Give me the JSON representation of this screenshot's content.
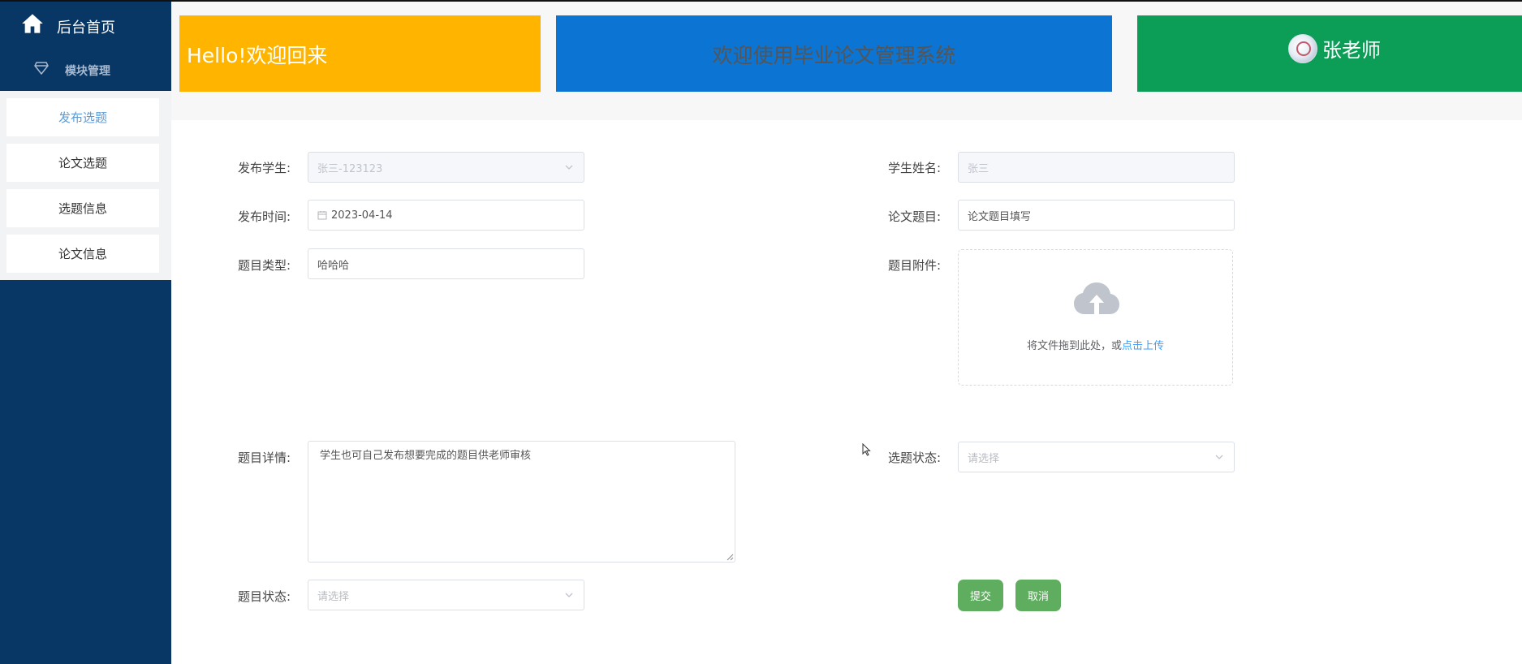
{
  "sidebar": {
    "home_label": "后台首页",
    "module_label": "模块管理",
    "items": [
      {
        "label": "发布选题",
        "active": true
      },
      {
        "label": "论文选题",
        "active": false
      },
      {
        "label": "选题信息",
        "active": false
      },
      {
        "label": "论文信息",
        "active": false
      }
    ]
  },
  "header": {
    "greeting": "Hello!欢迎回来",
    "system_title": "欢迎使用毕业论文管理系统",
    "user_name": "张老师"
  },
  "form": {
    "publish_student": {
      "label": "发布学生:",
      "value": "张三-123123"
    },
    "student_name": {
      "label": "学生姓名:",
      "value": "张三"
    },
    "publish_time": {
      "label": "发布时间:",
      "value": "2023-04-14"
    },
    "thesis_title": {
      "label": "论文题目:",
      "value": "论文题目填写"
    },
    "topic_type": {
      "label": "题目类型:",
      "value": "哈哈哈"
    },
    "attachment": {
      "label": "题目附件:",
      "hint": "将文件拖到此处，或",
      "link": "点击上传"
    },
    "topic_detail": {
      "label": "题目详情:",
      "value": "学生也可自己发布想要完成的题目供老师审核"
    },
    "selection_status": {
      "label": "选题状态:",
      "placeholder": "请选择"
    },
    "topic_status": {
      "label": "题目状态:",
      "placeholder": "请选择"
    },
    "submit_label": "提交",
    "cancel_label": "取消"
  },
  "colors": {
    "sidebar_bg": "#083766",
    "banner_yellow": "#ffb500",
    "banner_blue": "#0c74d2",
    "banner_green": "#0c9d57",
    "button_green": "#5fae5f",
    "link_blue": "#409eff"
  },
  "icons": {
    "home": "home-icon",
    "module": "diamond-icon",
    "calendar": "calendar-icon",
    "upload": "cloud-upload-icon",
    "dropdown": "chevron-down-icon"
  }
}
